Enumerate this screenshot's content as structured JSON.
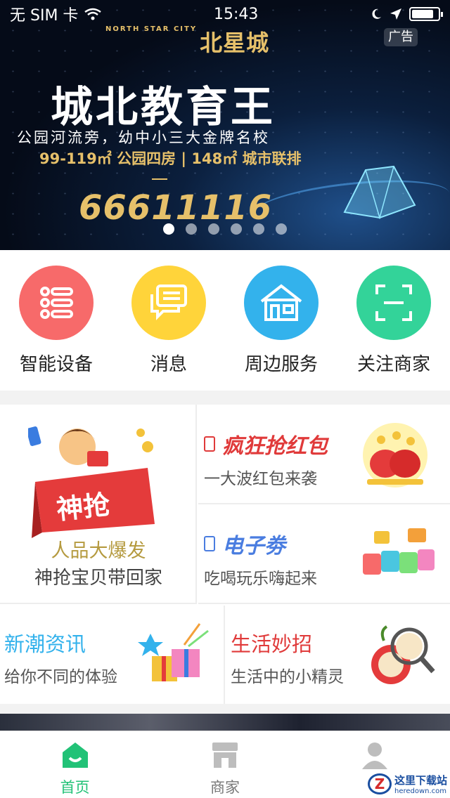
{
  "status_bar": {
    "carrier": "无 SIM 卡",
    "time": "15:43"
  },
  "banner": {
    "logo": "北星城",
    "logo_small": "NORTH STAR CITY",
    "ad_tag": "广告",
    "headline": "城北教育王",
    "subline": "公园河流旁，幼中小三大金牌名校",
    "promo": "99-119㎡ 公园四房 | 148㎡ 城市联排",
    "phone": "66611116",
    "page_count": 6,
    "active_page": 0
  },
  "quick_entries": [
    {
      "label": "智能设备",
      "icon": "list-icon",
      "color": "#f76a6a"
    },
    {
      "label": "消息",
      "icon": "message-icon",
      "color": "#ffd43a"
    },
    {
      "label": "周边服务",
      "icon": "house-icon",
      "color": "#33b2ec"
    },
    {
      "label": "关注商家",
      "icon": "scan-icon",
      "color": "#33d399"
    }
  ],
  "promo_cards": {
    "big": {
      "title": "人品大爆发",
      "subtitle": "神抢宝贝带回家",
      "badge": "神抢"
    },
    "right_top": {
      "title": "疯狂抢红包",
      "subtitle": "一大波红包来袭",
      "color": "#e03a3a"
    },
    "right_bottom": {
      "title": "电子劵",
      "subtitle": "吃喝玩乐嗨起来",
      "color": "#4a7de0"
    },
    "bottom_left": {
      "title": "新潮资讯",
      "subtitle": "给你不同的体验",
      "color": "#33b2ec"
    },
    "bottom_right": {
      "title": "生活妙招",
      "subtitle": "生活中的小精灵",
      "color": "#e03a3a"
    }
  },
  "tab_bar": [
    {
      "label": "首页",
      "active": true
    },
    {
      "label": "商家",
      "active": false
    },
    {
      "label": "",
      "active": false
    }
  ],
  "watermark": {
    "cn": "这里下载站",
    "en": "heredown.com"
  },
  "colors": {
    "accent": "#22c277"
  }
}
